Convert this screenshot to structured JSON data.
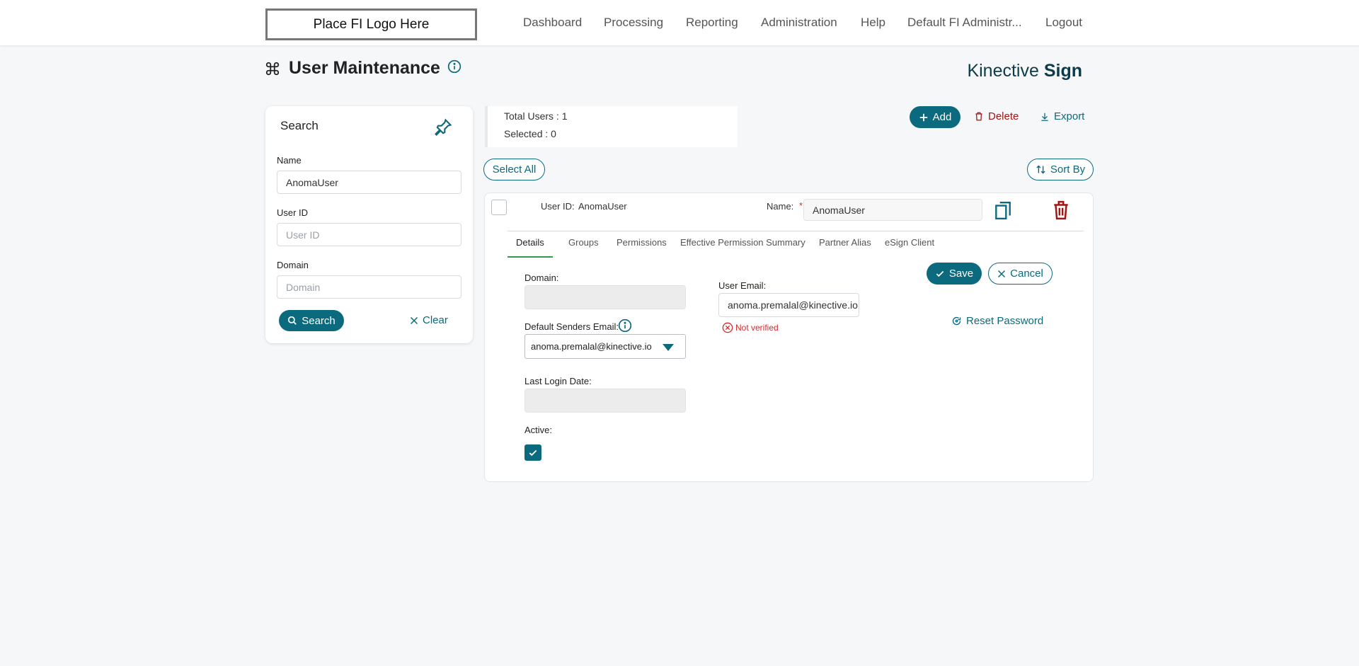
{
  "header": {
    "logo_text": "Place FI Logo Here",
    "nav": [
      "Dashboard",
      "Processing",
      "Reporting",
      "Administration",
      "Help",
      "Default FI Administr...",
      "Logout"
    ]
  },
  "page": {
    "title": "User Maintenance",
    "brand_light": "Kinective ",
    "brand_bold": "Sign"
  },
  "search": {
    "title": "Search",
    "name_label": "Name",
    "name_value": "AnomaUser",
    "userid_label": "User ID",
    "userid_placeholder": "User ID",
    "domain_label": "Domain",
    "domain_placeholder": "Domain",
    "search_button": "Search",
    "clear_button": "Clear"
  },
  "stats": {
    "total_users": "Total Users : 1",
    "selected": "Selected : 0"
  },
  "actions": {
    "add": "Add",
    "delete": "Delete",
    "export": "Export",
    "select_all": "Select All",
    "sort_by": "Sort By"
  },
  "user": {
    "userid_label": "User ID:",
    "userid_value": "AnomaUser",
    "name_label": "Name:",
    "required_mark": "*",
    "name_value": "AnomaUser",
    "tabs": [
      "Details",
      "Groups",
      "Permissions",
      "Effective Permission Summary",
      "Partner Alias",
      "eSign Client"
    ],
    "active_tab": "Details",
    "domain_label": "Domain:",
    "default_senders_label": "Default Senders Email:",
    "default_senders_value": "anoma.premalal@kinective.io",
    "last_login_label": "Last Login Date:",
    "active_label": "Active:",
    "active_checked": true,
    "user_email_label": "User Email:",
    "user_email_value": "anoma.premalal@kinective.io",
    "not_verified": "Not verified",
    "save_button": "Save",
    "cancel_button": "Cancel",
    "reset_password": "Reset Password"
  },
  "colors": {
    "primary": "#0b6a7d",
    "danger": "#a31515",
    "error": "#d9292b",
    "active_tab": "#2c9c4a"
  }
}
